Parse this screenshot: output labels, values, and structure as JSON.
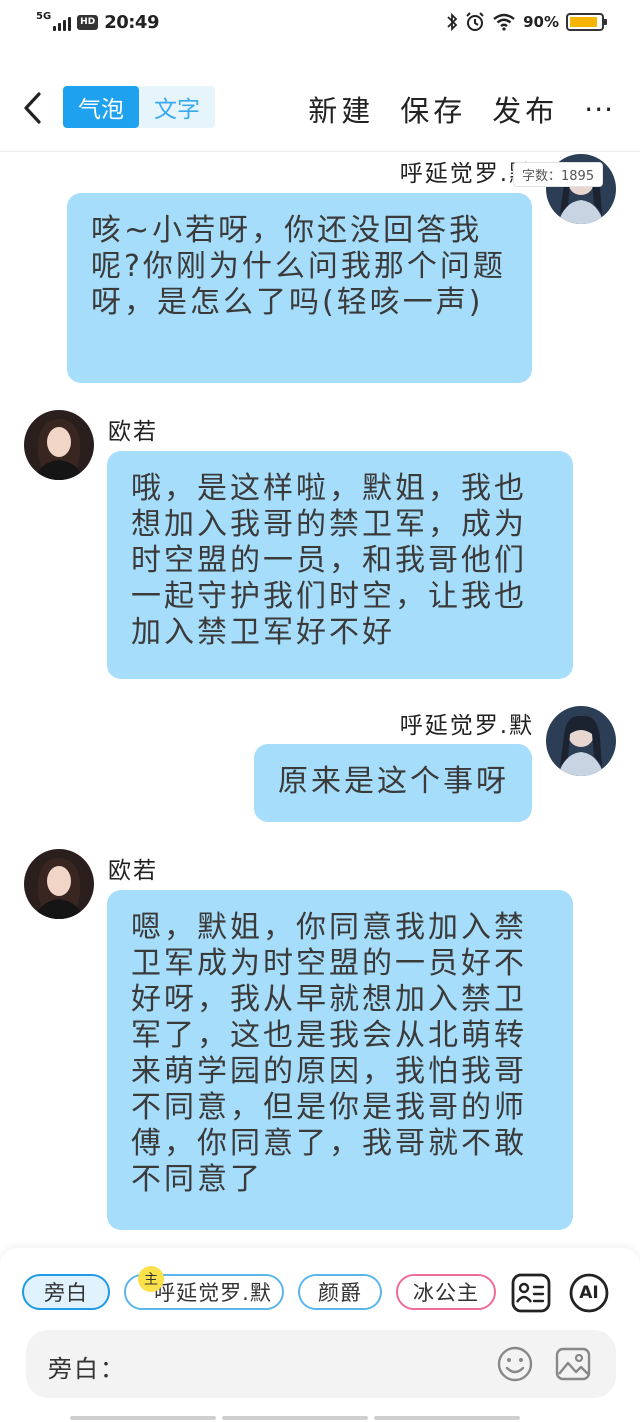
{
  "status_bar": {
    "network": "5G",
    "hd_badge": "HD",
    "time": "20:49",
    "battery_pct": "90%",
    "battery_level": 0.9,
    "battery_color": "#f7b500"
  },
  "header": {
    "tabs": [
      "气泡",
      "文字"
    ],
    "active_tab": "气泡",
    "actions": {
      "new": "新建",
      "save": "保存",
      "publish": "发布",
      "more": "···"
    }
  },
  "word_count": "字数：1895",
  "messages": [
    {
      "speaker": "呼延觉罗.默",
      "side": "right",
      "text": "咳~小若呀，你还没回答我呢?你刚为什么问我那个问题呀，是怎么了吗(轻咳一声)"
    },
    {
      "speaker": "欧若",
      "side": "left",
      "text": "哦，是这样啦，默姐，我也想加入我哥的禁卫军，成为时空盟的一员，和我哥他们一起守护我们时空，让我也加入禁卫军好不好"
    },
    {
      "speaker": "呼延觉罗.默",
      "side": "right",
      "text": "原来是这个事呀"
    },
    {
      "speaker": "欧若",
      "side": "left",
      "text": "嗯，默姐，你同意我加入禁卫军成为时空盟的一员好不好呀，我从早就想加入禁卫军了，这也是我会从北萌转来萌学园的原因，我怕我哥不同意，但是你是我哥的师傅，你同意了，我哥就不敢不同意了"
    }
  ],
  "bottom": {
    "characters": [
      "旁白",
      "呼延觉罗.默",
      "颜爵",
      "冰公主"
    ],
    "selected_character": "旁白",
    "main_badge": "主",
    "ai_label": "AI",
    "input_label": "旁白：",
    "input_value": "",
    "colors": {
      "bubble": "#a6ddfb",
      "accent": "#1ea2f0"
    }
  }
}
